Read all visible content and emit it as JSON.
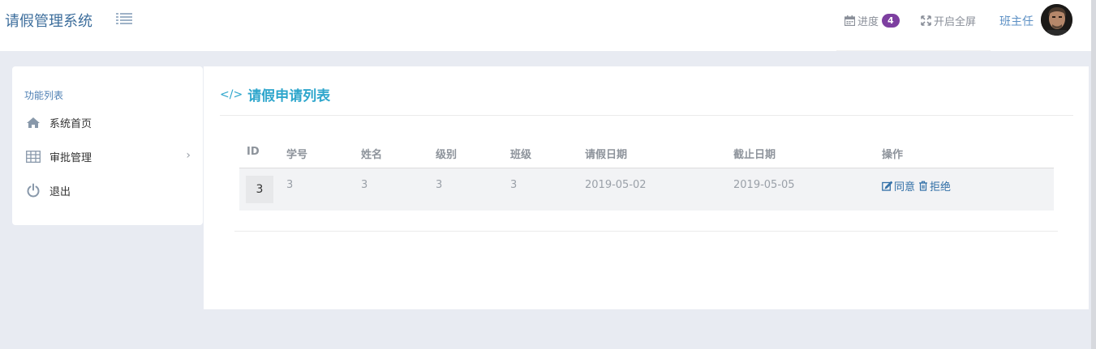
{
  "header": {
    "brand": "请假管理系统",
    "menu_toggle_icon": "list-icon",
    "progress_label": "进度",
    "progress_badge": "4",
    "fullscreen_label": "开启全屏",
    "user_name": "班主任"
  },
  "sidebar": {
    "title": "功能列表",
    "items": [
      {
        "label": "系统首页",
        "icon": "home-icon"
      },
      {
        "label": "审批管理",
        "icon": "table-icon"
      },
      {
        "label": "退出",
        "icon": "power-icon"
      }
    ]
  },
  "main": {
    "title": "请假申请列表",
    "table": {
      "headers": [
        "ID",
        "学号",
        "姓名",
        "级别",
        "班级",
        "请假日期",
        "截止日期",
        "操作"
      ],
      "rows": [
        {
          "id": "3",
          "student_no": "3",
          "name": "3",
          "level": "3",
          "class": "3",
          "start_date": "2019-05-02",
          "end_date": "2019-05-05"
        }
      ],
      "actions": {
        "agree": "同意",
        "reject": "拒绝"
      }
    }
  },
  "colors": {
    "accent": "#2ea6cc",
    "brand": "#3d6e9c",
    "badge": "#7d3fa0",
    "link": "#2f6ea6",
    "page_bg": "#e8ebf2"
  }
}
